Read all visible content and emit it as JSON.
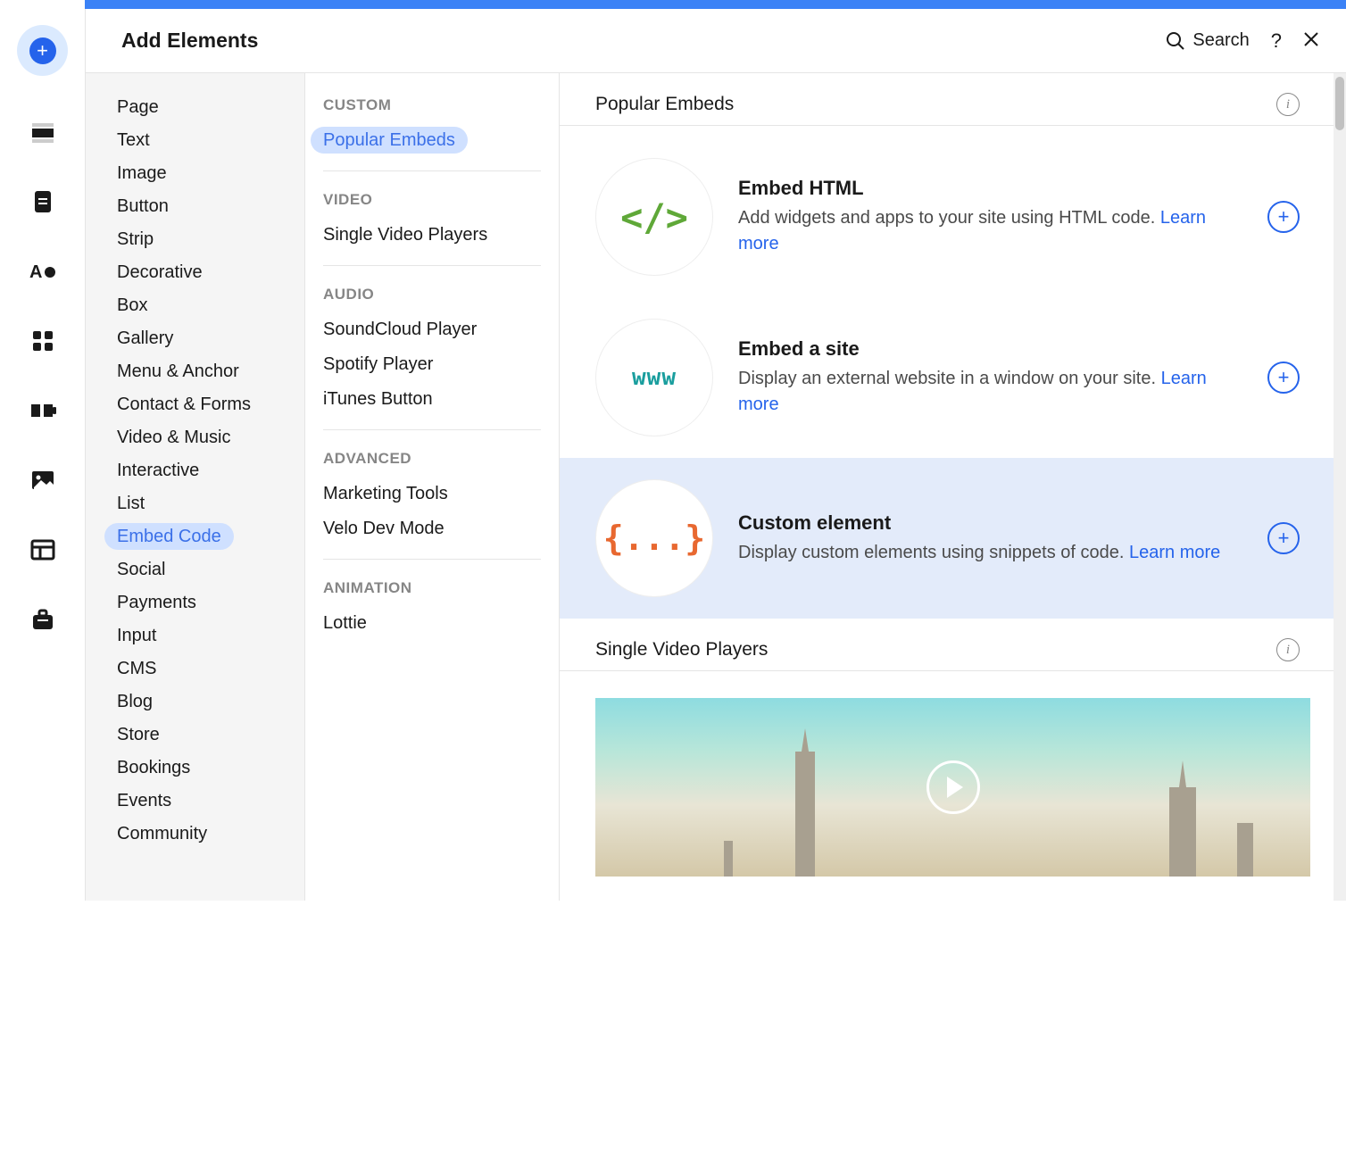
{
  "header": {
    "title": "Add Elements",
    "search_label": "Search"
  },
  "categories": [
    "Page",
    "Text",
    "Image",
    "Button",
    "Strip",
    "Decorative",
    "Box",
    "Gallery",
    "Menu & Anchor",
    "Contact & Forms",
    "Video & Music",
    "Interactive",
    "List",
    "Embed Code",
    "Social",
    "Payments",
    "Input",
    "CMS",
    "Blog",
    "Store",
    "Bookings",
    "Events",
    "Community"
  ],
  "active_category": "Embed Code",
  "sub_sections": [
    {
      "header": "CUSTOM",
      "items": [
        "Popular Embeds"
      ],
      "active": "Popular Embeds"
    },
    {
      "header": "VIDEO",
      "items": [
        "Single Video Players"
      ]
    },
    {
      "header": "AUDIO",
      "items": [
        "SoundCloud Player",
        "Spotify Player",
        "iTunes Button"
      ]
    },
    {
      "header": "ADVANCED",
      "items": [
        "Marketing Tools",
        "Velo Dev Mode"
      ]
    },
    {
      "header": "ANIMATION",
      "items": [
        "Lottie"
      ]
    }
  ],
  "content": {
    "section1_title": "Popular Embeds",
    "section2_title": "Single Video Players",
    "learn_more": "Learn more",
    "embeds": [
      {
        "title": "Embed HTML",
        "desc": "Add widgets and apps to your site using HTML code.",
        "icon_text": "</>",
        "icon_class": "html-tag"
      },
      {
        "title": "Embed a site",
        "desc": "Display an external website in a window on your site.",
        "icon_text": "www",
        "icon_class": "www-txt"
      },
      {
        "title": "Custom element",
        "desc": "Display custom elements using snippets of code.",
        "icon_text": "{...}",
        "icon_class": "brace-txt",
        "highlight": true
      }
    ]
  }
}
